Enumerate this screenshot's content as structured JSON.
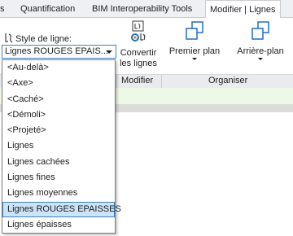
{
  "tabs": [
    {
      "label": "s"
    },
    {
      "label": "Quantification"
    },
    {
      "label": "BIM Interoperability Tools"
    },
    {
      "label": "Modifier | Lignes"
    }
  ],
  "style": {
    "label": "Style de ligne:",
    "current_value": "Lignes ROUGES EPAIS...",
    "options": [
      "<Au-delà>",
      "<Axe>",
      "<Caché>",
      "<Démoli>",
      "<Projeté>",
      "Lignes",
      "Lignes cachées",
      "Lignes fines",
      "Lignes moyennes",
      "Lignes ROUGES EPAISSES",
      "Lignes épaisses"
    ],
    "selected_option": "Lignes ROUGES EPAISSES"
  },
  "tools": {
    "convertir_line1": "Convertir",
    "convertir_line2": "les lignes",
    "premier_plan": "Premier plan",
    "arriere_plan": "Arrière-plan"
  },
  "panels": {
    "modifier": "Modifier",
    "organiser": "Organiser"
  },
  "colors": {
    "accent": "#3d7fc1",
    "selection": "#cce4f7",
    "icon_blue": "#1f6fc5"
  }
}
